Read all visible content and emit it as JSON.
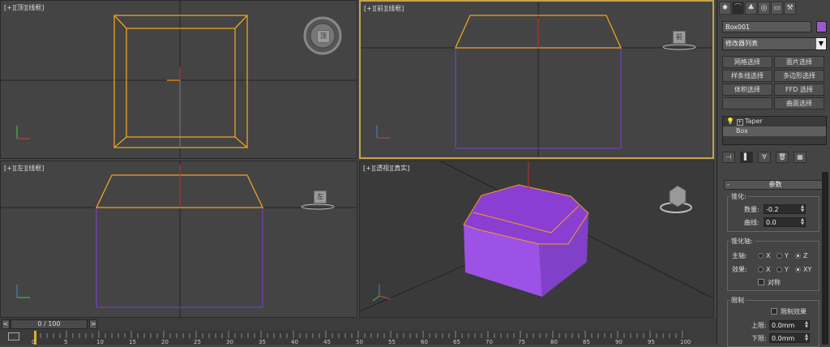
{
  "viewports": {
    "top": {
      "label": "[+][顶][线框]",
      "cube_label": "顶"
    },
    "front": {
      "label": "[+][前][线框]",
      "cube_label": "前"
    },
    "left": {
      "label": "[+][左][线框]",
      "cube_label": "左"
    },
    "perspective": {
      "label": "[+][透视][真实]"
    }
  },
  "command_panel": {
    "tabs": [
      {
        "icon": "create-icon",
        "glyph": "✹"
      },
      {
        "icon": "modify-icon",
        "glyph": "⌒"
      },
      {
        "icon": "hierarchy-icon",
        "glyph": "♣"
      },
      {
        "icon": "motion-icon",
        "glyph": "◎"
      },
      {
        "icon": "display-icon",
        "glyph": "▭"
      },
      {
        "icon": "utilities-icon",
        "glyph": "⚒"
      }
    ],
    "object_name": "Box001",
    "object_color": "#9b59d0",
    "modifier_list": "修改器列表",
    "selection_buttons": [
      [
        "网格选择",
        "面片选择"
      ],
      [
        "样条线选择",
        "多边形选择"
      ],
      [
        "体积选择",
        "FFD 选择"
      ],
      [
        "",
        "曲面选择"
      ]
    ],
    "stack": [
      "Taper",
      "Box"
    ],
    "rollout": {
      "title": "参数",
      "taper_group": "锥化:",
      "amount_label": "数量:",
      "amount": "-0.2",
      "curve_label": "曲线:",
      "curve": "0.0",
      "axis_group": "锥化轴:",
      "primary_label": "主轴:",
      "effect_label": "效果:",
      "primary_options": [
        "X",
        "Y",
        "Z"
      ],
      "effect_options": [
        "X",
        "Y",
        "XY"
      ],
      "symmetry_label": "对称",
      "limits_group": "限制",
      "limit_effect_label": "限制效果",
      "upper_label": "上限:",
      "upper": "0.0mm",
      "lower_label": "下限:",
      "lower": "0.0mm"
    }
  },
  "timeline": {
    "slider_text": "0 / 100",
    "ticks": [
      "0",
      "5",
      "10",
      "15",
      "20",
      "25",
      "30",
      "35",
      "40",
      "45",
      "50",
      "55",
      "60",
      "65",
      "70",
      "75",
      "80",
      "85",
      "90",
      "95",
      "100"
    ]
  }
}
